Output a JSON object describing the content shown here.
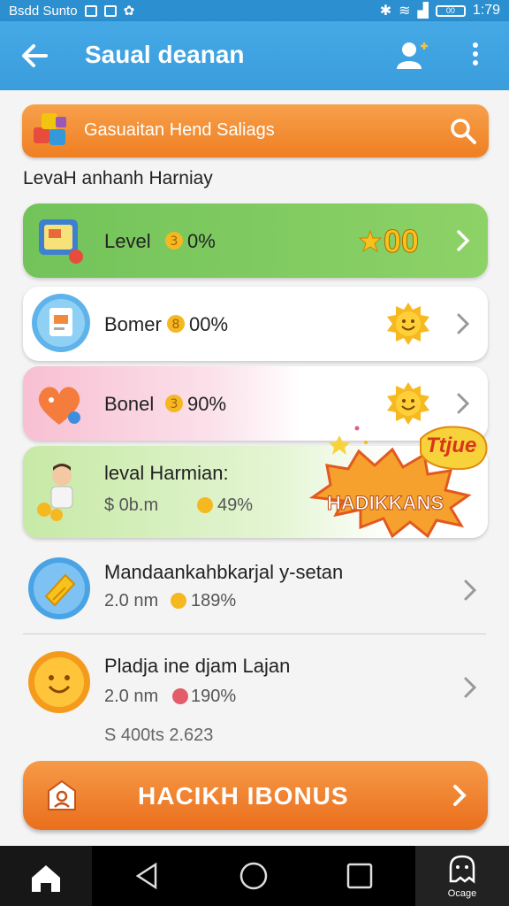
{
  "status_bar": {
    "carrier": "Bsdd Sunto",
    "time": "1:79",
    "battery": "00"
  },
  "app_bar": {
    "title": "Saual deanan"
  },
  "search": {
    "label": "Gasuaitan Hend Saliags"
  },
  "section": {
    "title": "LevaH anhanh Harniay"
  },
  "cards": [
    {
      "label": "Level",
      "percent": "0%",
      "reward": "00"
    },
    {
      "label": "Bomer",
      "percent": "00%"
    },
    {
      "label": "Bonel",
      "percent": "90%"
    },
    {
      "label": "leval Harmian:",
      "sub_amount": "$ 0b.m",
      "sub_percent": "49%",
      "badge_main": "HADIKKANS",
      "badge_corner": "Ttjue"
    }
  ],
  "rows": [
    {
      "title": "Mandaankahbkarjal y-setan",
      "sub": "2.0 nm",
      "sub_percent": "189%"
    },
    {
      "title": "Pladja ine djam Lajan",
      "sub": "2.0 nm",
      "sub_percent": "190%",
      "extra": "S 400ts 2.623"
    }
  ],
  "bonus_button": {
    "label": "HACIKH IBONUS"
  },
  "nav": {
    "ghost_label": "Ocage"
  },
  "colors": {
    "app_bar": "#3b9ddc",
    "orange": "#ef7f22",
    "green_card": "#7ac75a",
    "pink_card": "#f9c9d6"
  }
}
